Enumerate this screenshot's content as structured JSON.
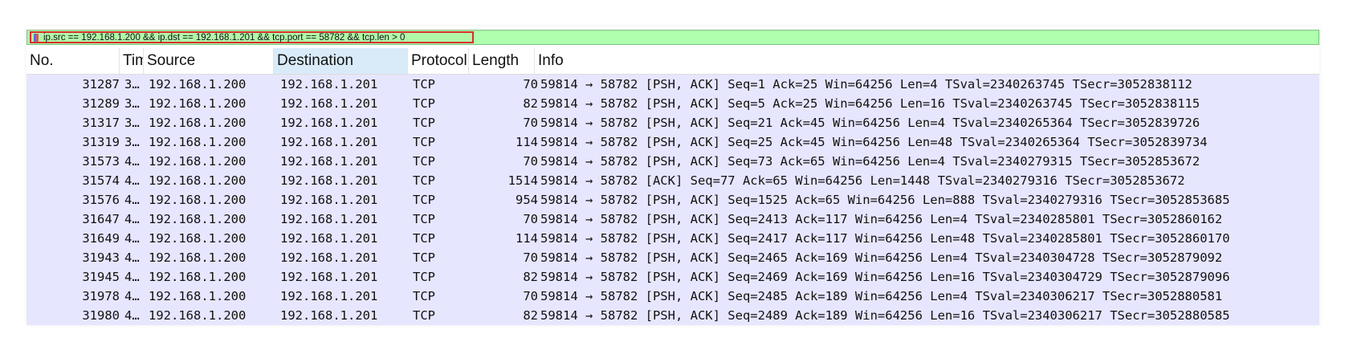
{
  "filter": {
    "expression": "ip.src == 192.168.1.200 && ip.dst == 192.168.1.201 && tcp.port == 58782 && tcp.len > 0",
    "bookmark_icon": "bookmark-icon",
    "background_color": "#afffaf",
    "highlight_color": "#d9302c"
  },
  "columns": {
    "no": "No.",
    "time": "Time",
    "source": "Source",
    "destination": "Destination",
    "protocol": "Protocol",
    "length": "Length",
    "info": "Info",
    "sorted_column": "destination"
  },
  "row_color": "#e7e6ff",
  "packets": [
    {
      "no": "31287",
      "time": "3…",
      "source": "192.168.1.200",
      "destination": "192.168.1.201",
      "protocol": "TCP",
      "length": "70",
      "info": "59814 → 58782 [PSH, ACK] Seq=1 Ack=25 Win=64256 Len=4 TSval=2340263745 TSecr=3052838112"
    },
    {
      "no": "31289",
      "time": "3…",
      "source": "192.168.1.200",
      "destination": "192.168.1.201",
      "protocol": "TCP",
      "length": "82",
      "info": "59814 → 58782 [PSH, ACK] Seq=5 Ack=25 Win=64256 Len=16 TSval=2340263745 TSecr=3052838115"
    },
    {
      "no": "31317",
      "time": "3…",
      "source": "192.168.1.200",
      "destination": "192.168.1.201",
      "protocol": "TCP",
      "length": "70",
      "info": "59814 → 58782 [PSH, ACK] Seq=21 Ack=45 Win=64256 Len=4 TSval=2340265364 TSecr=3052839726"
    },
    {
      "no": "31319",
      "time": "3…",
      "source": "192.168.1.200",
      "destination": "192.168.1.201",
      "protocol": "TCP",
      "length": "114",
      "info": "59814 → 58782 [PSH, ACK] Seq=25 Ack=45 Win=64256 Len=48 TSval=2340265364 TSecr=3052839734"
    },
    {
      "no": "31573",
      "time": "4…",
      "source": "192.168.1.200",
      "destination": "192.168.1.201",
      "protocol": "TCP",
      "length": "70",
      "info": "59814 → 58782 [PSH, ACK] Seq=73 Ack=65 Win=64256 Len=4 TSval=2340279315 TSecr=3052853672"
    },
    {
      "no": "31574",
      "time": "4…",
      "source": "192.168.1.200",
      "destination": "192.168.1.201",
      "protocol": "TCP",
      "length": "1514",
      "info": "59814 → 58782 [ACK] Seq=77 Ack=65 Win=64256 Len=1448 TSval=2340279316 TSecr=3052853672"
    },
    {
      "no": "31576",
      "time": "4…",
      "source": "192.168.1.200",
      "destination": "192.168.1.201",
      "protocol": "TCP",
      "length": "954",
      "info": "59814 → 58782 [PSH, ACK] Seq=1525 Ack=65 Win=64256 Len=888 TSval=2340279316 TSecr=3052853685"
    },
    {
      "no": "31647",
      "time": "4…",
      "source": "192.168.1.200",
      "destination": "192.168.1.201",
      "protocol": "TCP",
      "length": "70",
      "info": "59814 → 58782 [PSH, ACK] Seq=2413 Ack=117 Win=64256 Len=4 TSval=2340285801 TSecr=3052860162"
    },
    {
      "no": "31649",
      "time": "4…",
      "source": "192.168.1.200",
      "destination": "192.168.1.201",
      "protocol": "TCP",
      "length": "114",
      "info": "59814 → 58782 [PSH, ACK] Seq=2417 Ack=117 Win=64256 Len=48 TSval=2340285801 TSecr=3052860170"
    },
    {
      "no": "31943",
      "time": "4…",
      "source": "192.168.1.200",
      "destination": "192.168.1.201",
      "protocol": "TCP",
      "length": "70",
      "info": "59814 → 58782 [PSH, ACK] Seq=2465 Ack=169 Win=64256 Len=4 TSval=2340304728 TSecr=3052879092"
    },
    {
      "no": "31945",
      "time": "4…",
      "source": "192.168.1.200",
      "destination": "192.168.1.201",
      "protocol": "TCP",
      "length": "82",
      "info": "59814 → 58782 [PSH, ACK] Seq=2469 Ack=169 Win=64256 Len=16 TSval=2340304729 TSecr=3052879096"
    },
    {
      "no": "31978",
      "time": "4…",
      "source": "192.168.1.200",
      "destination": "192.168.1.201",
      "protocol": "TCP",
      "length": "70",
      "info": "59814 → 58782 [PSH, ACK] Seq=2485 Ack=189 Win=64256 Len=4 TSval=2340306217 TSecr=3052880581"
    },
    {
      "no": "31980",
      "time": "4…",
      "source": "192.168.1.200",
      "destination": "192.168.1.201",
      "protocol": "TCP",
      "length": "82",
      "info": "59814 → 58782 [PSH, ACK] Seq=2489 Ack=189 Win=64256 Len=16 TSval=2340306217 TSecr=3052880585"
    }
  ]
}
